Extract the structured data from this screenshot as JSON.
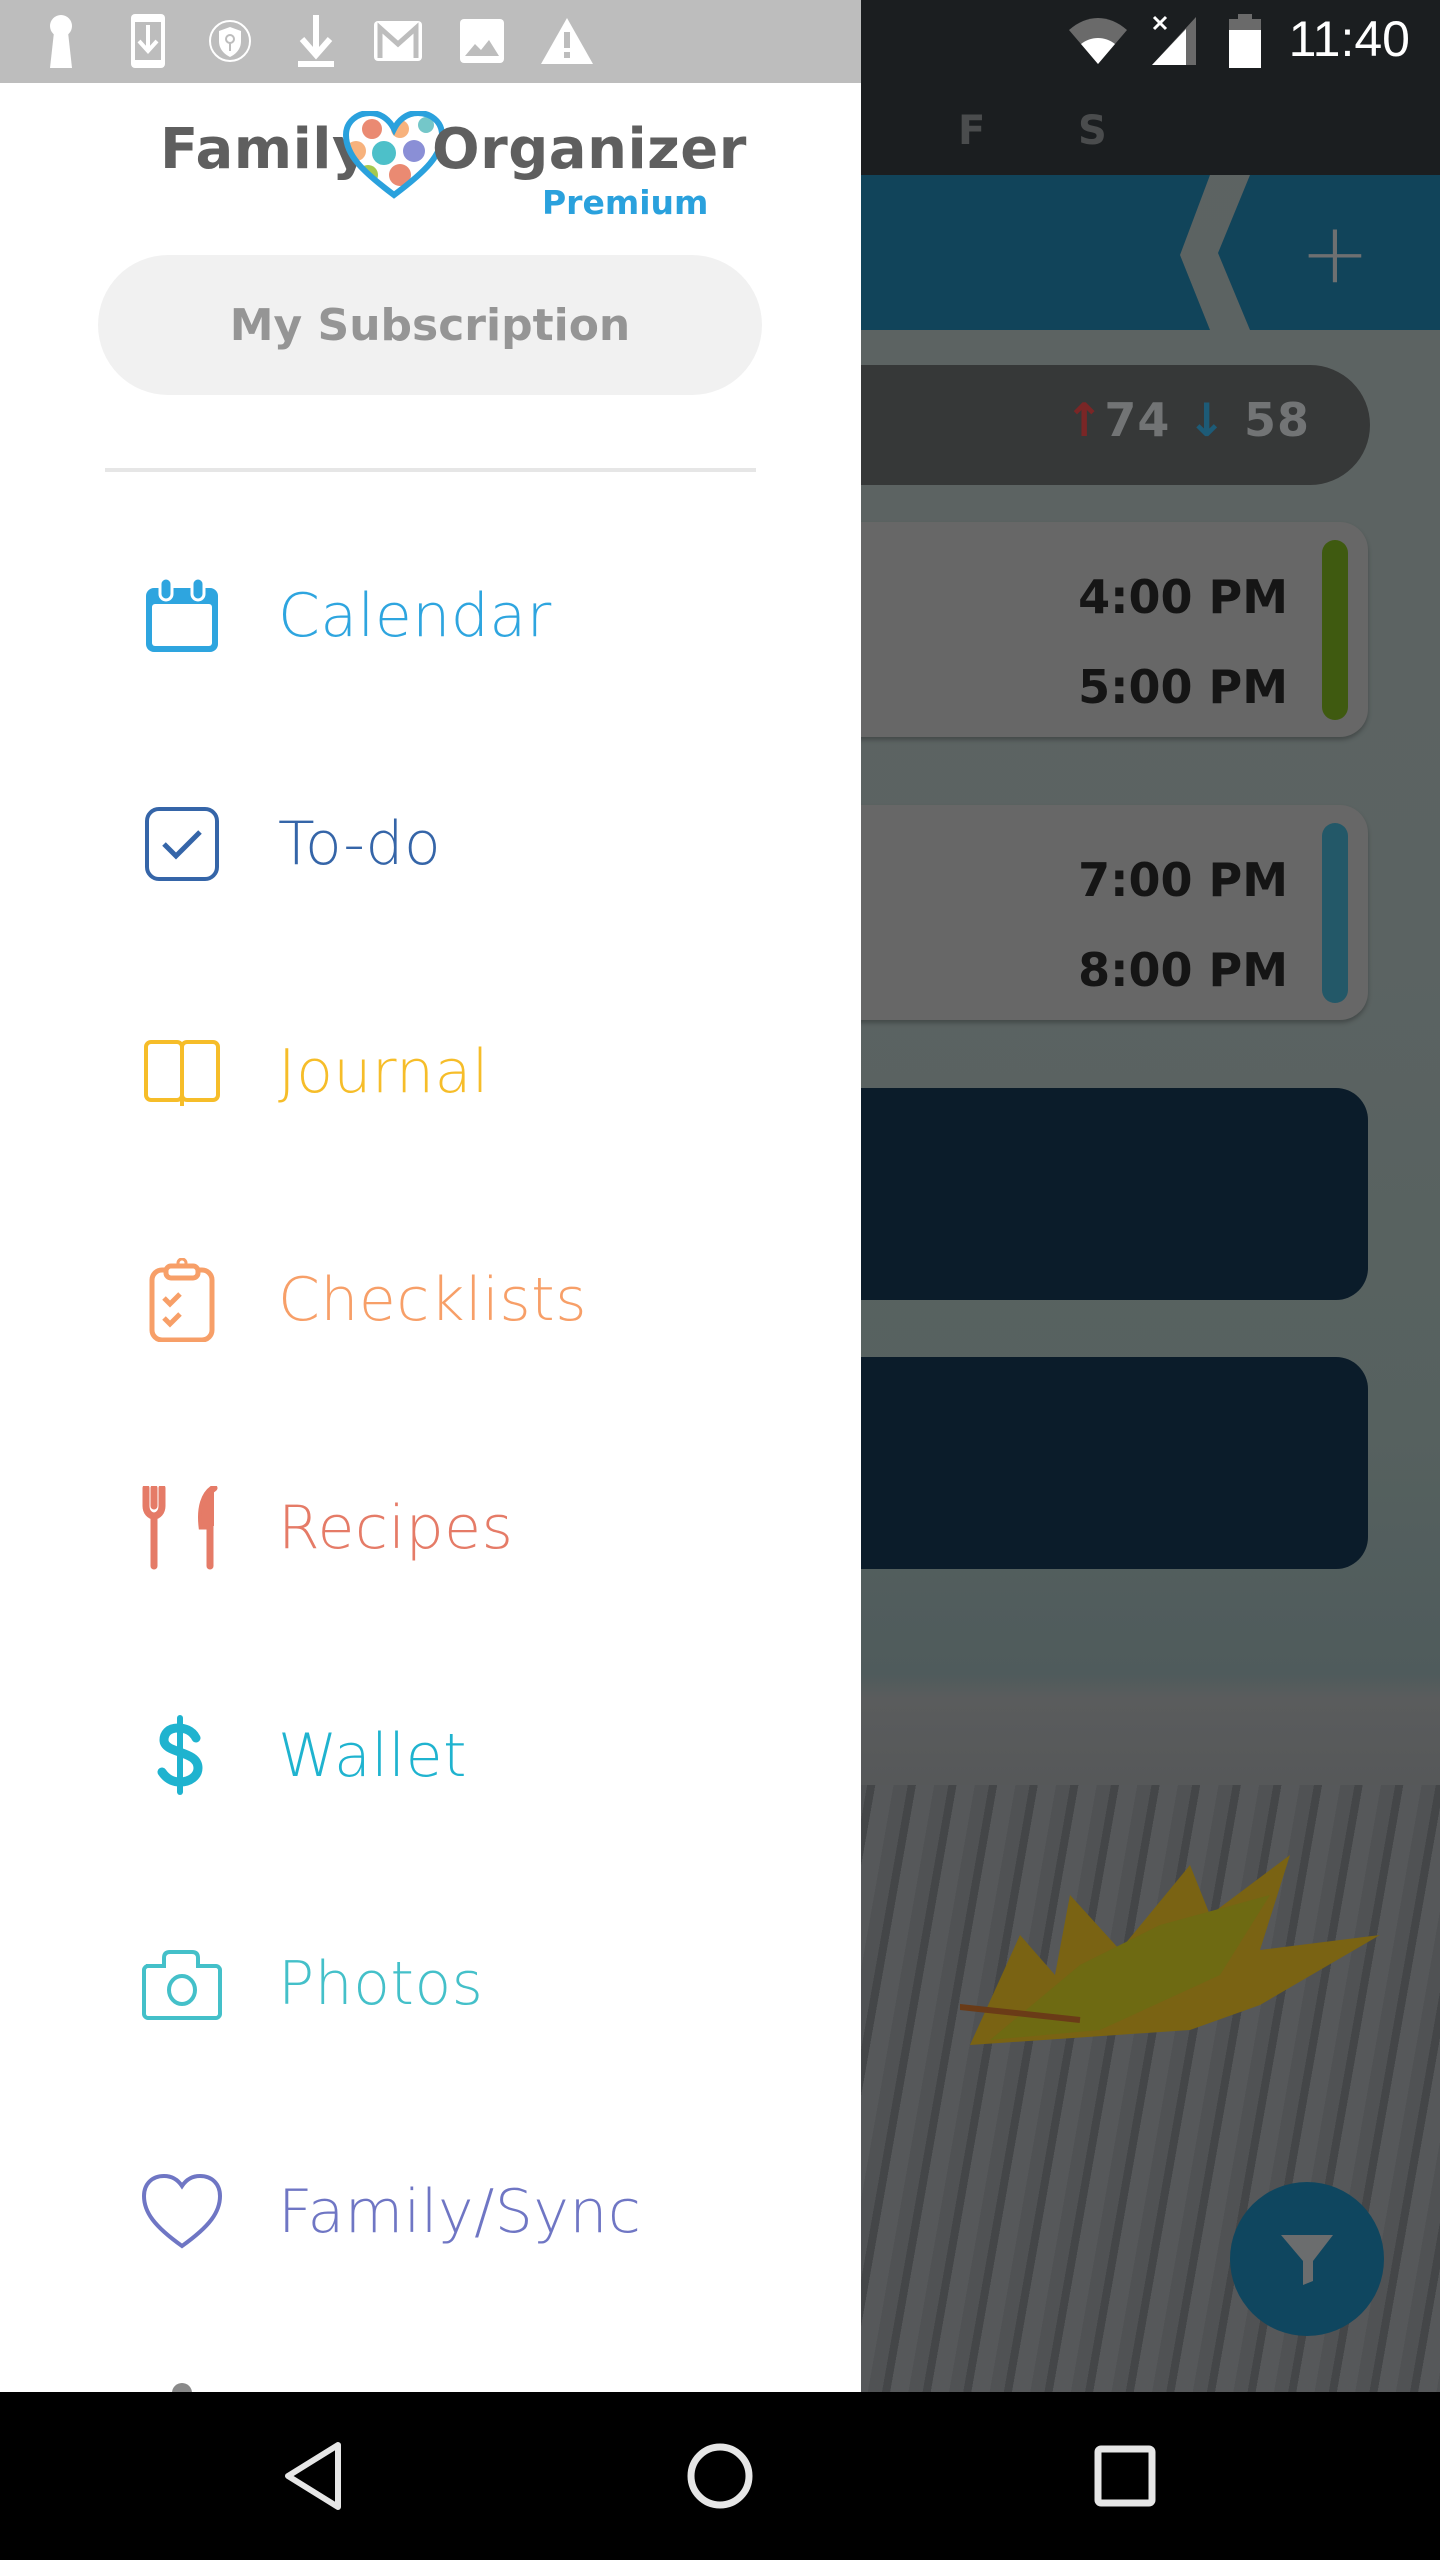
{
  "status_bar": {
    "time": "11:40",
    "left_icons": [
      "keyhole-icon",
      "phone-download-icon",
      "vpn-shield-icon",
      "download-icon",
      "gmail-icon",
      "image-icon",
      "warning-icon"
    ],
    "right_icons": [
      "wifi-icon",
      "cell-signal-no-service-icon",
      "battery-icon"
    ]
  },
  "drawer": {
    "logo": {
      "word_left": "Family",
      "word_right": "Organizer",
      "tier": "Premium",
      "heart_outline_color": "#2aa1dd"
    },
    "subscription_button": "My Subscription",
    "menu_items": [
      {
        "label": "Calendar",
        "icon": "calendar-icon",
        "color": "#2ea5df"
      },
      {
        "label": "To-do",
        "icon": "checkbox-icon",
        "color": "#3565a8"
      },
      {
        "label": "Journal",
        "icon": "book-icon",
        "color": "#f6bd29"
      },
      {
        "label": "Checklists",
        "icon": "clipboard-check-icon",
        "color": "#f79f68"
      },
      {
        "label": "Recipes",
        "icon": "fork-knife-icon",
        "color": "#e57b67"
      },
      {
        "label": "Wallet",
        "icon": "dollar-icon",
        "color": "#1fb3cf"
      },
      {
        "label": "Photos",
        "icon": "camera-icon",
        "color": "#44c0c9"
      },
      {
        "label": "Family/Sync",
        "icon": "heart-icon",
        "color": "#6f76c4"
      }
    ]
  },
  "background_app": {
    "day_letters": [
      "F",
      "S"
    ],
    "add_button": "+",
    "weather": {
      "high": "74",
      "low": "58"
    },
    "events": [
      {
        "start": "4:00 PM",
        "end": "5:00 PM",
        "color": "#3f5a10"
      },
      {
        "start": "7:00 PM",
        "end": "8:00 PM",
        "color": "#235868"
      }
    ],
    "filter_button": "filter-icon"
  },
  "nav_bar": {
    "buttons": [
      "back-icon",
      "home-icon",
      "recents-icon"
    ]
  }
}
